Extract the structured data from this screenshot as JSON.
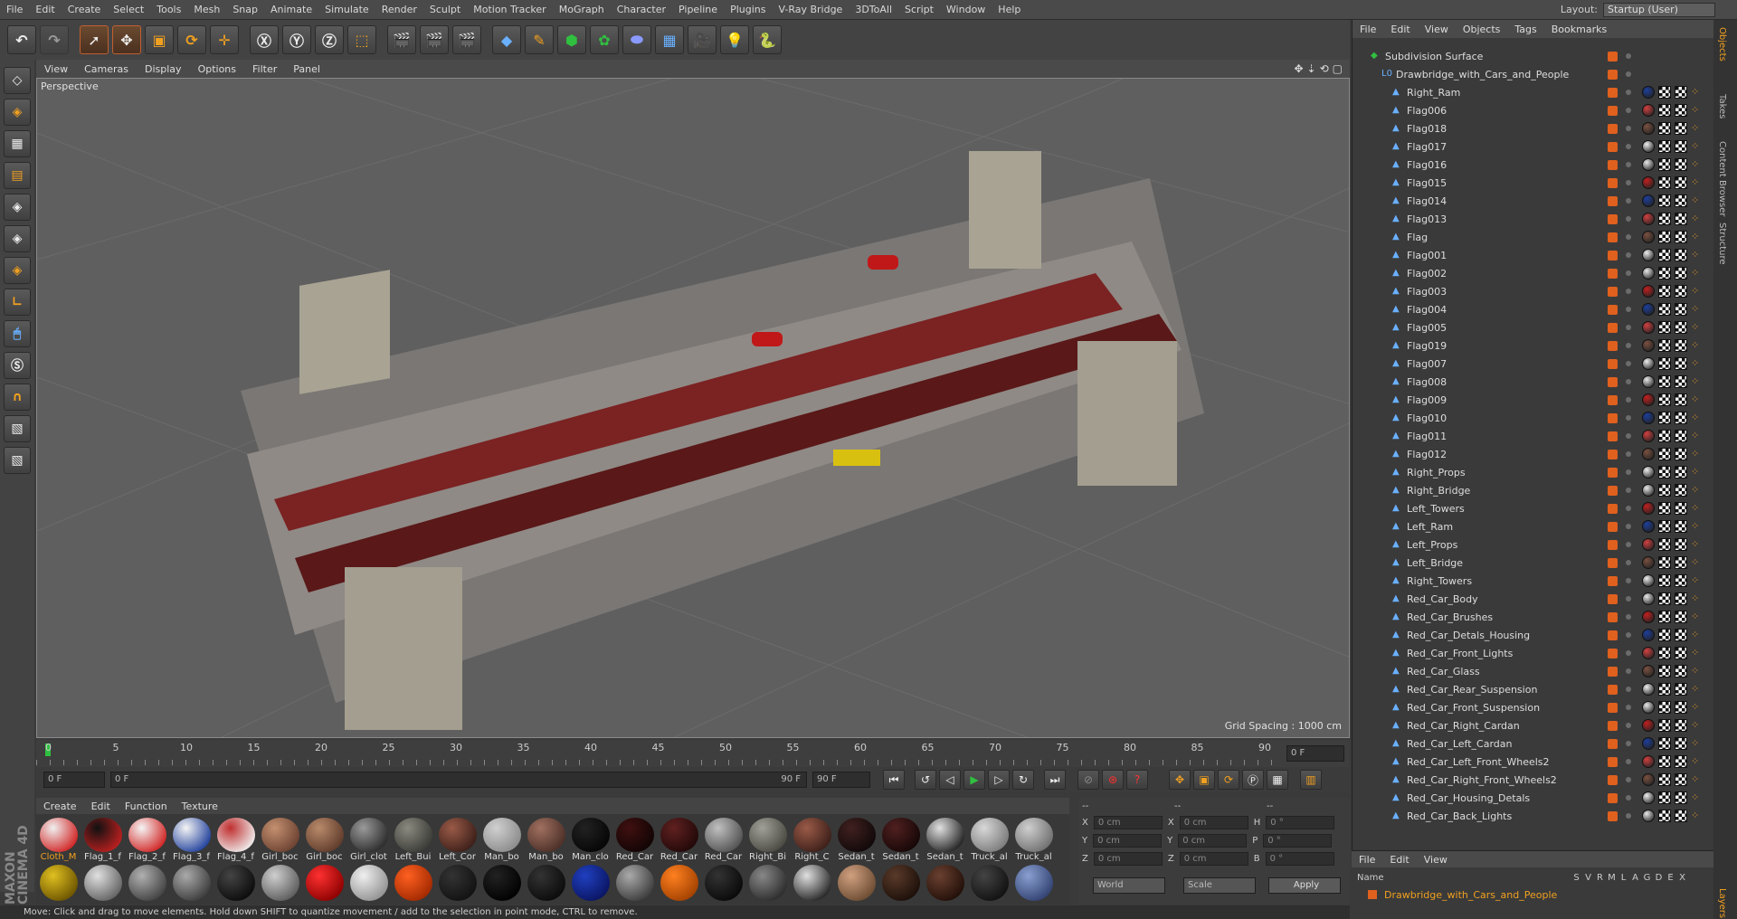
{
  "menubar": [
    "File",
    "Edit",
    "Create",
    "Select",
    "Tools",
    "Mesh",
    "Snap",
    "Animate",
    "Simulate",
    "Render",
    "Sculpt",
    "Motion Tracker",
    "MoGraph",
    "Character",
    "Pipeline",
    "Plugins",
    "V-Ray Bridge",
    "3DToAll",
    "Script",
    "Window",
    "Help"
  ],
  "layout": {
    "label": "Layout:",
    "value": "Startup (User)"
  },
  "viewport": {
    "menus": [
      "View",
      "Cameras",
      "Display",
      "Options",
      "Filter",
      "Panel"
    ],
    "label": "Perspective",
    "grid_spacing": "Grid Spacing : 1000 cm"
  },
  "timeline": {
    "ticks": [
      "0",
      "5",
      "10",
      "15",
      "20",
      "25",
      "30",
      "35",
      "40",
      "45",
      "50",
      "55",
      "60",
      "65",
      "70",
      "75",
      "80",
      "85",
      "90"
    ],
    "end_field": "0 F",
    "current": "0 F",
    "start": "0 F",
    "range_end": "90 F",
    "range_end2": "90 F"
  },
  "materials_menu": [
    "Create",
    "Edit",
    "Function",
    "Texture"
  ],
  "materials": [
    {
      "name": "Cloth_M",
      "c1": "#f0f0f0",
      "c2": "#d02020"
    },
    {
      "name": "Flag_1_f",
      "c1": "#111",
      "c2": "#c02020"
    },
    {
      "name": "Flag_2_f",
      "c1": "#f5f5f5",
      "c2": "#d02020"
    },
    {
      "name": "Flag_3_f",
      "c1": "#f5f5f5",
      "c2": "#1d3e9a"
    },
    {
      "name": "Flag_4_f",
      "c1": "#c03030",
      "c2": "#f0f0f0"
    },
    {
      "name": "Girl_boc",
      "c1": "#c49070",
      "c2": "#6a4030"
    },
    {
      "name": "Girl_boc",
      "c1": "#b88a6a",
      "c2": "#5e3a2a"
    },
    {
      "name": "Girl_clot",
      "c1": "#9a9a9a",
      "c2": "#2a2a2a"
    },
    {
      "name": "Left_Bui",
      "c1": "#8a8a80",
      "c2": "#3a3a36"
    },
    {
      "name": "Left_Cor",
      "c1": "#9a5a48",
      "c2": "#3a1e18"
    },
    {
      "name": "Man_bo",
      "c1": "#d0d0d0",
      "c2": "#8a8a8a"
    },
    {
      "name": "Man_bo",
      "c1": "#a07060",
      "c2": "#4a2e26"
    },
    {
      "name": "Man_clo",
      "c1": "#222",
      "c2": "#050505"
    },
    {
      "name": "Red_Car",
      "c1": "#401010",
      "c2": "#100404"
    },
    {
      "name": "Red_Car",
      "c1": "#602020",
      "c2": "#200808"
    },
    {
      "name": "Red_Car",
      "c1": "#c0c0c0",
      "c2": "#505050"
    },
    {
      "name": "Right_Bi",
      "c1": "#a0a098",
      "c2": "#484840"
    },
    {
      "name": "Right_C",
      "c1": "#9a5a48",
      "c2": "#3a1e18"
    },
    {
      "name": "Sedan_t",
      "c1": "#402020",
      "c2": "#100808"
    },
    {
      "name": "Sedan_t",
      "c1": "#502020",
      "c2": "#150606"
    },
    {
      "name": "Sedan_t",
      "c1": "#e0e0e0",
      "c2": "#202020"
    },
    {
      "name": "Truck_al",
      "c1": "#d8d8d8",
      "c2": "#7a7a7a"
    },
    {
      "name": "Truck_al",
      "c1": "#cfcfcf",
      "c2": "#6e6e6e"
    },
    {
      "name": "",
      "c1": "#e0c020",
      "c2": "#6a5200"
    },
    {
      "name": "",
      "c1": "#e0e0e0",
      "c2": "#606060"
    },
    {
      "name": "",
      "c1": "#b0b0b0",
      "c2": "#404040"
    },
    {
      "name": "",
      "c1": "#aaaaaa",
      "c2": "#3a3a3a"
    },
    {
      "name": "",
      "c1": "#444",
      "c2": "#0a0a0a"
    },
    {
      "name": "",
      "c1": "#cfcfcf",
      "c2": "#5a5a5a"
    },
    {
      "name": "",
      "c1": "#ff3030",
      "c2": "#8a0000"
    },
    {
      "name": "",
      "c1": "#f0f0f0",
      "c2": "#909090"
    },
    {
      "name": "",
      "c1": "#ff6020",
      "c2": "#a02800"
    },
    {
      "name": "",
      "c1": "#333",
      "c2": "#111"
    },
    {
      "name": "",
      "c1": "#222",
      "c2": "#000"
    },
    {
      "name": "",
      "c1": "#333",
      "c2": "#0a0a0a"
    },
    {
      "name": "",
      "c1": "#2040c0",
      "c2": "#0a1460"
    },
    {
      "name": "",
      "c1": "#aaa",
      "c2": "#3a3a3a"
    },
    {
      "name": "",
      "c1": "#ff8020",
      "c2": "#a04000"
    },
    {
      "name": "",
      "c1": "#333",
      "c2": "#080808"
    },
    {
      "name": "",
      "c1": "#888",
      "c2": "#2a2a2a"
    },
    {
      "name": "",
      "c1": "#e0e0e0",
      "c2": "#222"
    },
    {
      "name": "",
      "c1": "#d0a080",
      "c2": "#6a4a30"
    },
    {
      "name": "",
      "c1": "#5a3a2a",
      "c2": "#1a0e08"
    },
    {
      "name": "",
      "c1": "#6a4030",
      "c2": "#200e08"
    },
    {
      "name": "",
      "c1": "#444",
      "c2": "#101010"
    },
    {
      "name": "",
      "c1": "#8aa0d0",
      "c2": "#304070"
    }
  ],
  "coords": {
    "header": [
      "--",
      "--",
      "--"
    ],
    "rows": [
      {
        "a": "X",
        "av": "0 cm",
        "b": "X",
        "bv": "0 cm",
        "c": "H",
        "cv": "0 °"
      },
      {
        "a": "Y",
        "av": "0 cm",
        "b": "Y",
        "bv": "0 cm",
        "c": "P",
        "cv": "0 °"
      },
      {
        "a": "Z",
        "av": "0 cm",
        "b": "Z",
        "bv": "0 cm",
        "c": "B",
        "cv": "0 °"
      }
    ],
    "world": "World",
    "scale": "Scale",
    "apply": "Apply"
  },
  "status": "Move: Click and drag to move elements. Hold down SHIFT to quantize movement / add to the selection in point mode, CTRL to remove.",
  "object_menu": [
    "File",
    "Edit",
    "View",
    "Objects",
    "Tags",
    "Bookmarks"
  ],
  "objects": [
    {
      "name": "Subdivision Surface",
      "level": 0,
      "tags": 0
    },
    {
      "name": "Drawbridge_with_Cars_and_People",
      "level": 1,
      "tags": 0
    },
    {
      "name": "Right_Ram",
      "level": 2,
      "tags": 1
    },
    {
      "name": "Flag006",
      "level": 2,
      "tags": 1
    },
    {
      "name": "Flag018",
      "level": 2,
      "tags": 1
    },
    {
      "name": "Flag017",
      "level": 2,
      "tags": 1
    },
    {
      "name": "Flag016",
      "level": 2,
      "tags": 1
    },
    {
      "name": "Flag015",
      "level": 2,
      "tags": 1
    },
    {
      "name": "Flag014",
      "level": 2,
      "tags": 1
    },
    {
      "name": "Flag013",
      "level": 2,
      "tags": 1
    },
    {
      "name": "Flag",
      "level": 2,
      "tags": 1
    },
    {
      "name": "Flag001",
      "level": 2,
      "tags": 1
    },
    {
      "name": "Flag002",
      "level": 2,
      "tags": 1
    },
    {
      "name": "Flag003",
      "level": 2,
      "tags": 1
    },
    {
      "name": "Flag004",
      "level": 2,
      "tags": 1
    },
    {
      "name": "Flag005",
      "level": 2,
      "tags": 1
    },
    {
      "name": "Flag019",
      "level": 2,
      "tags": 1
    },
    {
      "name": "Flag007",
      "level": 2,
      "tags": 1
    },
    {
      "name": "Flag008",
      "level": 2,
      "tags": 1
    },
    {
      "name": "Flag009",
      "level": 2,
      "tags": 1
    },
    {
      "name": "Flag010",
      "level": 2,
      "tags": 1
    },
    {
      "name": "Flag011",
      "level": 2,
      "tags": 1
    },
    {
      "name": "Flag012",
      "level": 2,
      "tags": 1
    },
    {
      "name": "Right_Props",
      "level": 2,
      "tags": 1
    },
    {
      "name": "Right_Bridge",
      "level": 2,
      "tags": 1
    },
    {
      "name": "Left_Towers",
      "level": 2,
      "tags": 1
    },
    {
      "name": "Left_Ram",
      "level": 2,
      "tags": 1
    },
    {
      "name": "Left_Props",
      "level": 2,
      "tags": 1
    },
    {
      "name": "Left_Bridge",
      "level": 2,
      "tags": 1
    },
    {
      "name": "Right_Towers",
      "level": 2,
      "tags": 1
    },
    {
      "name": "Red_Car_Body",
      "level": 2,
      "tags": 1
    },
    {
      "name": "Red_Car_Brushes",
      "level": 2,
      "tags": 1
    },
    {
      "name": "Red_Car_Detals_Housing",
      "level": 2,
      "tags": 1
    },
    {
      "name": "Red_Car_Front_Lights",
      "level": 2,
      "tags": 1
    },
    {
      "name": "Red_Car_Glass",
      "level": 2,
      "tags": 1
    },
    {
      "name": "Red_Car_Rear_Suspension",
      "level": 2,
      "tags": 1
    },
    {
      "name": "Red_Car_Front_Suspension",
      "level": 2,
      "tags": 1
    },
    {
      "name": "Red_Car_Right_Cardan",
      "level": 2,
      "tags": 1
    },
    {
      "name": "Red_Car_Left_Cardan",
      "level": 2,
      "tags": 1
    },
    {
      "name": "Red_Car_Left_Front_Wheels2",
      "level": 2,
      "tags": 1
    },
    {
      "name": "Red_Car_Right_Front_Wheels2",
      "level": 2,
      "tags": 1
    },
    {
      "name": "Red_Car_Housing_Detals",
      "level": 2,
      "tags": 1
    },
    {
      "name": "Red_Car_Back_Lights",
      "level": 2,
      "tags": 1
    }
  ],
  "sidetabs": [
    "Objects",
    "Takes",
    "Content Browser",
    "Structure",
    "Layers"
  ],
  "layer_menu": [
    "File",
    "Edit",
    "View"
  ],
  "layer_head": [
    "Name",
    "S",
    "V",
    "R",
    "M",
    "L",
    "A",
    "G",
    "D",
    "E",
    "X"
  ],
  "layer_row": "Drawbridge_with_Cars_and_People"
}
